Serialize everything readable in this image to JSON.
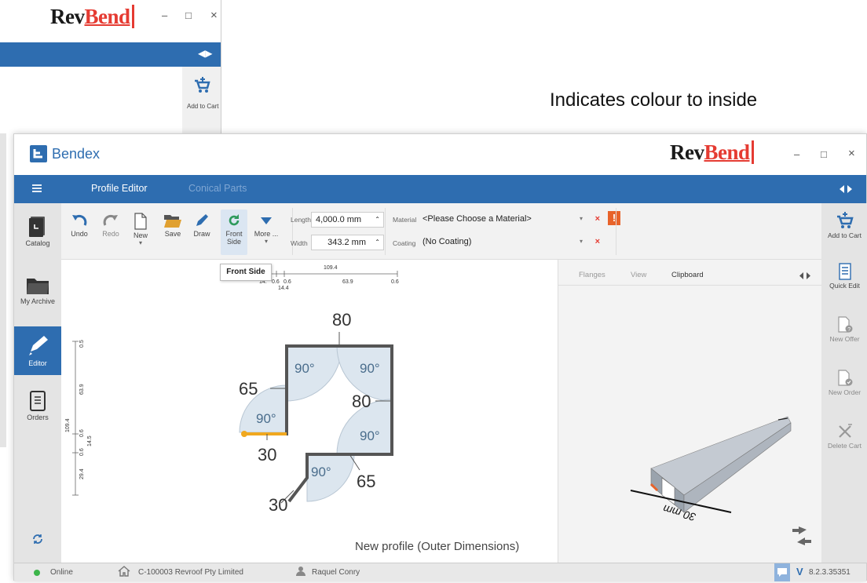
{
  "background_window": {
    "logo_rev": "Rev",
    "logo_bend": "Bend",
    "minimize": "–",
    "maximize": "□",
    "close": "×",
    "add_to_cart": "Add to Cart",
    "collapse_icon": "◀▶"
  },
  "annotation": "Indicates colour to inside",
  "app": {
    "name": "Bendex",
    "logo_rev": "Rev",
    "logo_bend": "Bend",
    "minimize": "–",
    "maximize": "□",
    "close": "×"
  },
  "nav": {
    "tabs": [
      {
        "label": "Profile Editor"
      },
      {
        "label": "Conical Parts"
      }
    ]
  },
  "sidebar": {
    "items": [
      {
        "label": "Catalog"
      },
      {
        "label": "My Archive"
      },
      {
        "label": "Editor"
      },
      {
        "label": "Orders"
      }
    ]
  },
  "toolbar": {
    "buttons": [
      {
        "label": "Undo"
      },
      {
        "label": "Redo"
      },
      {
        "label": "New"
      },
      {
        "label": "Save"
      },
      {
        "label": "Draw"
      },
      {
        "label": "Front Side"
      },
      {
        "label": "More ..."
      }
    ],
    "length_label": "Length",
    "length_value": "4,000.0 mm",
    "width_label": "Width",
    "width_value": "343.2 mm",
    "material_label": "Material",
    "material_value": "<Please Choose a Material>",
    "coating_label": "Coating",
    "coating_value": "(No Coating)",
    "tooltip": "Front Side"
  },
  "drawing": {
    "ruler_top": {
      "total": "109.4",
      "ticks": [
        "14.",
        "0.6",
        "0.6",
        "63.9",
        "0.6"
      ],
      "sub": "14.4"
    },
    "ruler_left": {
      "total": "109.4",
      "ticks": [
        "0.5",
        "63.9",
        "0.6",
        "0.6",
        "29.4"
      ],
      "sub": "14.5"
    },
    "dims": [
      "80",
      "65",
      "80",
      "30",
      "30",
      "65"
    ],
    "angles": [
      "90°",
      "90°",
      "90°",
      "90°",
      "90°"
    ],
    "caption": "New profile (Outer Dimensions)"
  },
  "right_panel": {
    "tabs": [
      {
        "label": "Flanges"
      },
      {
        "label": "View"
      },
      {
        "label": "Clipboard"
      }
    ],
    "dim_text": "30 mm"
  },
  "right_actions": [
    {
      "label": "Add to Cart"
    },
    {
      "label": "Quick Edit"
    },
    {
      "label": "New Offer"
    },
    {
      "label": "New Order"
    },
    {
      "label": "Delete Cart"
    }
  ],
  "status": {
    "online": "Online",
    "company": "C-100003 Revroof Pty Limited",
    "user": "Raquel Conry",
    "version": "8.2.3.35351",
    "version_mark": "V"
  },
  "colors": {
    "accent": "#2e6db0",
    "error": "#e53b32",
    "inside_marker": "#f0a820",
    "online": "#3cb54a"
  }
}
